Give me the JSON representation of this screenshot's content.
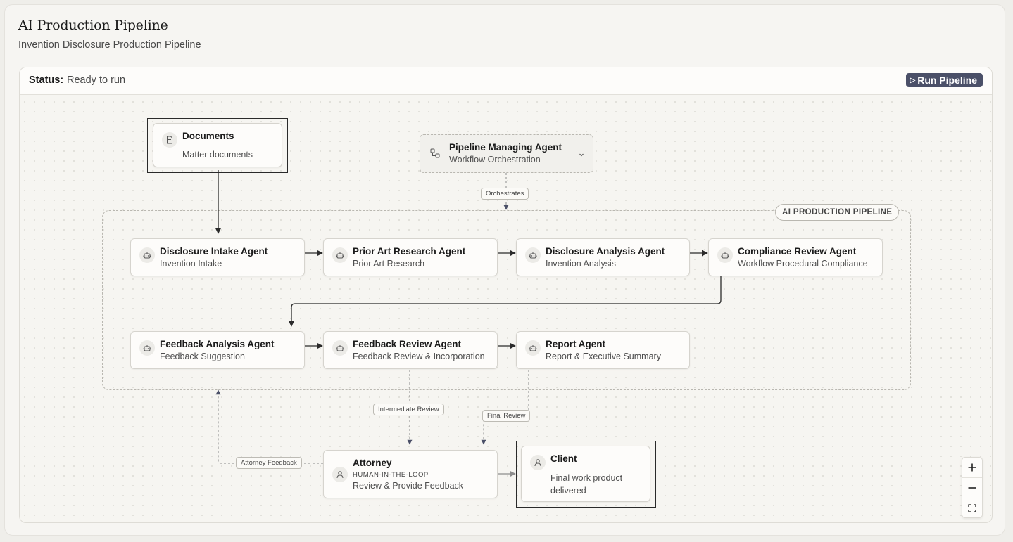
{
  "page": {
    "title": "AI Production Pipeline",
    "subtitle": "Invention Disclosure Production Pipeline"
  },
  "status": {
    "label": "Status:",
    "value": "Ready to run",
    "run_button": "Run Pipeline"
  },
  "group": {
    "label": "AI PRODUCTION PIPELINE"
  },
  "nodes": {
    "documents": {
      "title": "Documents",
      "subtitle": "Matter documents",
      "icon": "document-icon"
    },
    "manager": {
      "title": "Pipeline Managing Agent",
      "subtitle": "Workflow Orchestration",
      "icon": "workflow-icon"
    },
    "intake": {
      "title": "Disclosure Intake Agent",
      "subtitle": "Invention Intake",
      "icon": "robot-icon"
    },
    "prior_art": {
      "title": "Prior Art Research Agent",
      "subtitle": "Prior Art Research",
      "icon": "robot-icon"
    },
    "analysis": {
      "title": "Disclosure Analysis Agent",
      "subtitle": "Invention Analysis",
      "icon": "robot-icon"
    },
    "compliance": {
      "title": "Compliance Review Agent",
      "subtitle": "Workflow Procedural Compliance",
      "icon": "robot-icon"
    },
    "feedback_analysis": {
      "title": "Feedback Analysis Agent",
      "subtitle": "Feedback Suggestion",
      "icon": "robot-icon"
    },
    "feedback_review": {
      "title": "Feedback Review Agent",
      "subtitle": "Feedback Review & Incorporation",
      "icon": "robot-icon"
    },
    "report": {
      "title": "Report Agent",
      "subtitle": "Report & Executive Summary",
      "icon": "robot-icon"
    },
    "attorney": {
      "title": "Attorney",
      "tag": "HUMAN-IN-THE-LOOP",
      "subtitle": "Review & Provide Feedback",
      "icon": "user-icon"
    },
    "client": {
      "title": "Client",
      "subtitle": "Final work product delivered",
      "icon": "user-icon"
    }
  },
  "edge_labels": {
    "orchestrates": "Orchestrates",
    "intermediate_review": "Intermediate Review",
    "final_review": "Final Review",
    "attorney_feedback": "Attorney Feedback"
  },
  "colors": {
    "run_button_bg": "#4b5068",
    "edge_solid": "#2b2b2b",
    "edge_dashed": "#8a8a8a",
    "arrow_dashed": "#4b5068"
  }
}
